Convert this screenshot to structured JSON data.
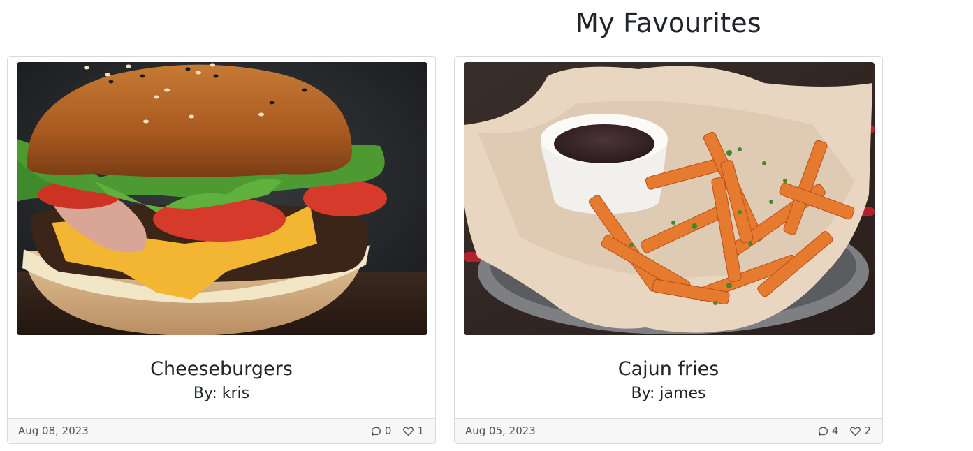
{
  "page": {
    "title": "My Favourites"
  },
  "cards": [
    {
      "title": "Cheeseburgers",
      "author": "By: kris",
      "date": "Aug 08, 2023",
      "comments": "0",
      "likes": "1",
      "image_icon": "burger-photo"
    },
    {
      "title": "Cajun fries",
      "author": "By: james",
      "date": "Aug 05, 2023",
      "comments": "4",
      "likes": "2",
      "image_icon": "fries-photo"
    }
  ],
  "icons": {
    "comment": "comment-icon",
    "like": "heart-icon"
  }
}
